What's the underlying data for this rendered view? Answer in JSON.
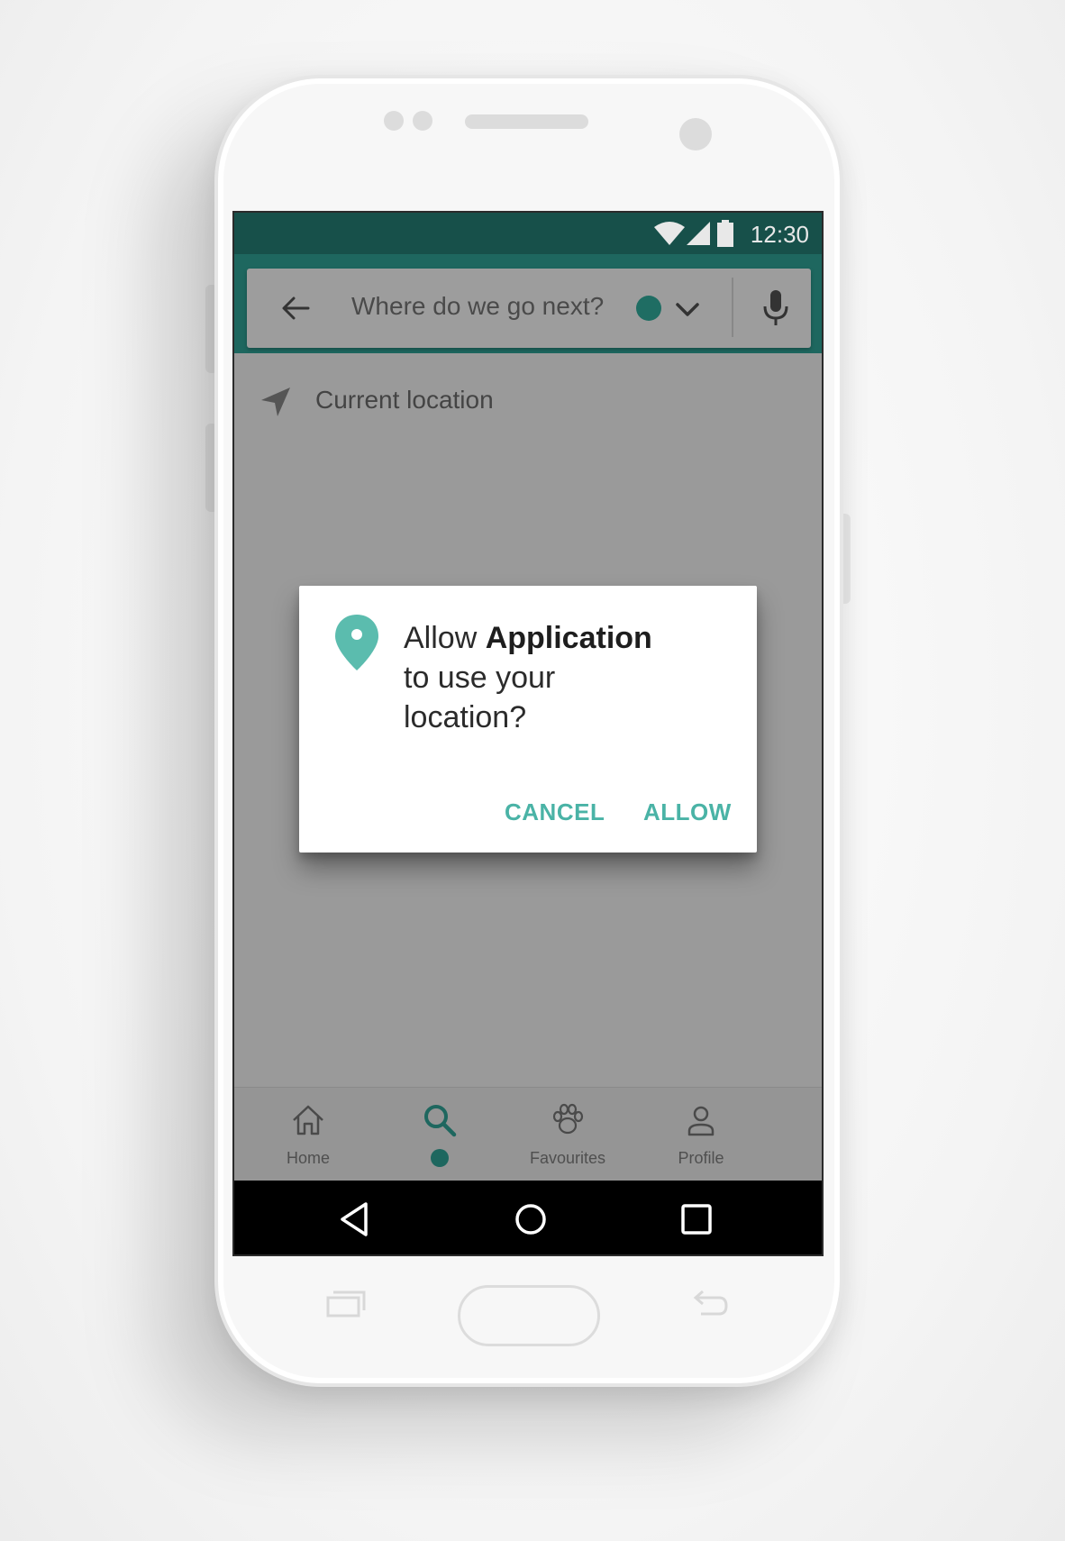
{
  "statusbar": {
    "time": "12:30"
  },
  "search": {
    "placeholder": "Where do we go next?"
  },
  "list": {
    "current_location": "Current location"
  },
  "dialog": {
    "prefix": "Allow ",
    "app_name": "Application",
    "suffix_line1": "to use your",
    "suffix_line2": "location?",
    "cancel_label": "CANCEL",
    "allow_label": "ALLOW"
  },
  "bottom_nav": {
    "items": [
      {
        "label": "Home",
        "icon": "home-icon"
      },
      {
        "label": "",
        "icon": "search-icon",
        "active": true
      },
      {
        "label": "Favourites",
        "icon": "paw-icon"
      },
      {
        "label": "Profile",
        "icon": "person-icon"
      }
    ]
  },
  "colors": {
    "status_bar": "#17504a",
    "app_bar": "#1e675f",
    "accent": "#4ab3a6",
    "scrim": "#9a9a9a"
  }
}
